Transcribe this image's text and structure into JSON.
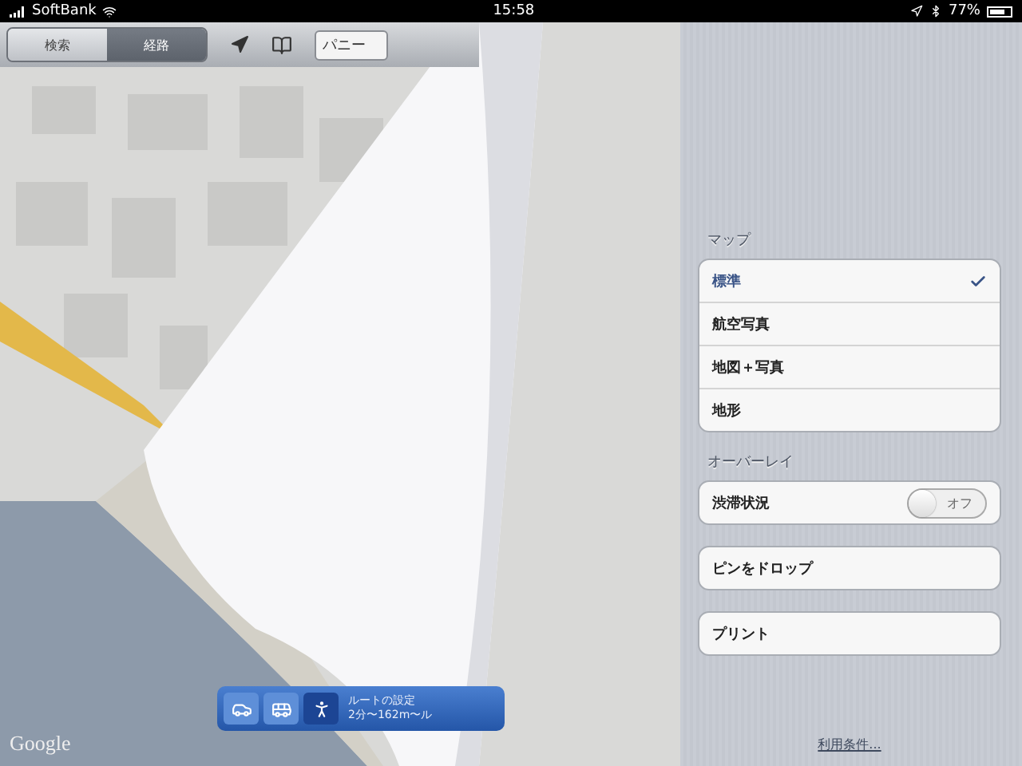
{
  "status_bar": {
    "carrier": "SoftBank",
    "time": "15:58",
    "battery": "77%"
  },
  "toolbar": {
    "segments": [
      {
        "label": "検索",
        "selected": false
      },
      {
        "label": "経路",
        "selected": true
      }
    ],
    "search_field": {
      "value": "パニー"
    }
  },
  "map": {
    "logo": "Google",
    "route_bar": {
      "modes": [
        {
          "kind": "car",
          "selected": false
        },
        {
          "kind": "bus",
          "selected": false
        },
        {
          "kind": "walk",
          "selected": true
        }
      ],
      "title": "ルートの設定",
      "summary": "2分〜162m〜ル"
    }
  },
  "settings": {
    "map_section": {
      "header": "マップ",
      "options": [
        {
          "label": "標準",
          "selected": true
        },
        {
          "label": "航空写真",
          "selected": false
        },
        {
          "label": "地図＋写真",
          "selected": false
        },
        {
          "label": "地形",
          "selected": false
        }
      ]
    },
    "overlay_section": {
      "header": "オーバーレイ",
      "items": [
        {
          "label": "渋滞状況",
          "on": false,
          "switch_label": "オフ"
        }
      ]
    },
    "actions": [
      "ピンをドロップ",
      "プリント"
    ],
    "footer_link": "利用条件..."
  }
}
